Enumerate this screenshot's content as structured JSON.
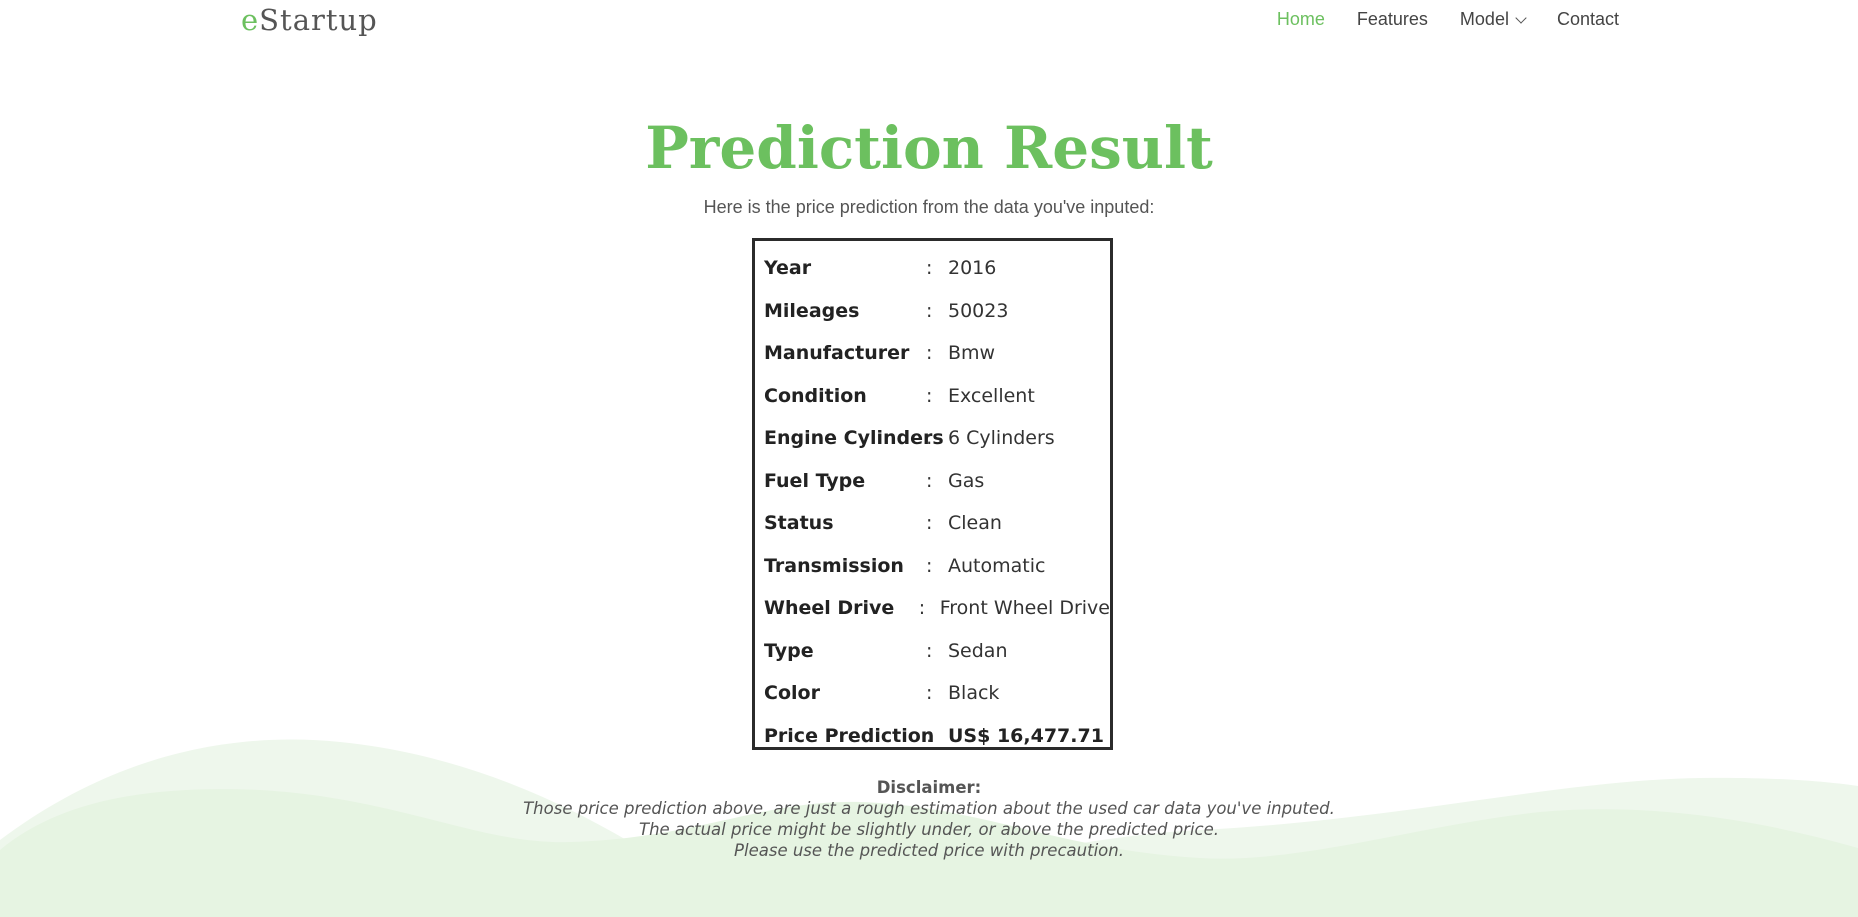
{
  "header": {
    "logo_accent": "e",
    "logo_rest": "Startup",
    "nav": [
      {
        "label": "Home",
        "active": true
      },
      {
        "label": "Features",
        "active": false
      },
      {
        "label": "Model",
        "active": false,
        "dropdown": true
      },
      {
        "label": "Contact",
        "active": false
      }
    ]
  },
  "main": {
    "title": "Prediction Result",
    "subtitle": "Here is the price prediction from the data you've inputed:",
    "rows": [
      {
        "label": "Year",
        "value": "2016"
      },
      {
        "label": "Mileages",
        "value": "50023"
      },
      {
        "label": "Manufacturer",
        "value": "Bmw"
      },
      {
        "label": "Condition",
        "value": "Excellent"
      },
      {
        "label": "Engine Cylinders",
        "value": "6 Cylinders"
      },
      {
        "label": "Fuel Type",
        "value": "Gas"
      },
      {
        "label": "Status",
        "value": "Clean"
      },
      {
        "label": "Transmission",
        "value": "Automatic"
      },
      {
        "label": "Wheel Drive",
        "value": "Front Wheel Drive"
      },
      {
        "label": "Type",
        "value": "Sedan"
      },
      {
        "label": "Color",
        "value": "Black"
      },
      {
        "label": "Price Prediction",
        "value": "US$ 16,477.71"
      }
    ],
    "separator": ":",
    "disclaimer": {
      "title": "Disclaimer:",
      "lines": [
        "Those price prediction above, are just a rough estimation about the used car data you've inputed.",
        "The actual price might be slightly under, or above the predicted price.",
        "Please use the predicted price with precaution."
      ]
    }
  },
  "colors": {
    "accent": "#6cc05f",
    "wave_light": "#eef7ec",
    "wave_mid": "#e3f2df"
  }
}
